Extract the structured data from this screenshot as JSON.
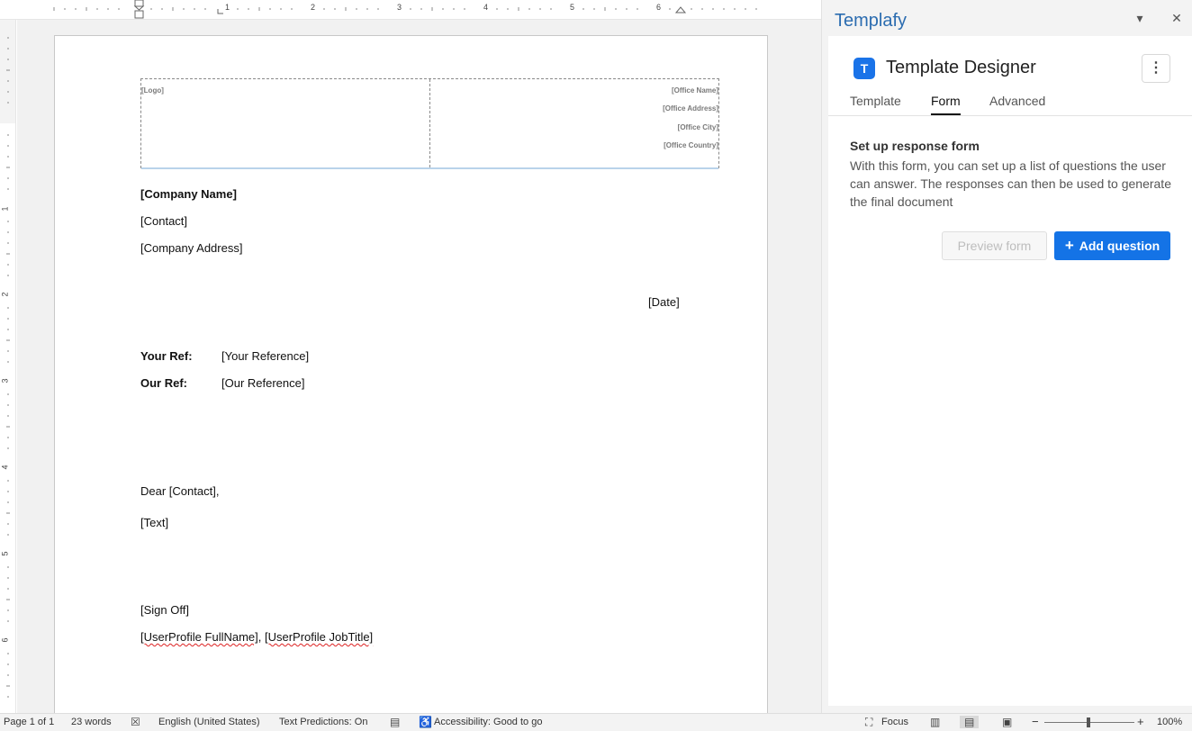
{
  "ruler": {
    "numbers": [
      "1",
      "2",
      "3",
      "4",
      "5",
      "6"
    ],
    "left_numbers": [
      "1",
      "2",
      "3",
      "4",
      "5",
      "6"
    ]
  },
  "letterhead": {
    "logo": "[Logo]",
    "office_name": "[Office Name]",
    "office_address": "[Office Address]",
    "office_city": "[Office City]",
    "office_country": "[Office Country]"
  },
  "document": {
    "company_name": "[Company Name]",
    "contact": "[Contact]",
    "company_address": "[Company Address]",
    "date": "[Date]",
    "your_ref_label": "Your Ref:",
    "your_ref_value": "[Your Reference]",
    "our_ref_label": "Our Ref:",
    "our_ref_value": "[Our Reference]",
    "greeting": "Dear [Contact],",
    "body": "[Text]",
    "sign_off": "[Sign Off]",
    "signature_name": "[UserProfile FullName]",
    "signature_sep": ", ",
    "signature_title": "[UserProfile JobTitle]"
  },
  "panel": {
    "title": "Templafy",
    "header_logo_letter": "T",
    "designer_title": "Template Designer",
    "tabs": [
      {
        "label": "Template",
        "active": false
      },
      {
        "label": "Form",
        "active": true
      },
      {
        "label": "Advanced",
        "active": false
      }
    ],
    "section_title": "Set up response form",
    "section_desc": "With this form, you can set up a list of questions the user can answer. The responses can then be used to generate the final document",
    "preview_label": "Preview form",
    "add_label": "Add question",
    "add_icon": "+",
    "accent": "#1473e6"
  },
  "status": {
    "page": "Page 1 of 1",
    "words": "23 words",
    "language": "English (United States)",
    "predictions": "Text Predictions: On",
    "accessibility": "Accessibility: Good to go",
    "focus": "Focus",
    "zoom": "100%",
    "zoom_minus": "−",
    "zoom_plus": "+"
  }
}
